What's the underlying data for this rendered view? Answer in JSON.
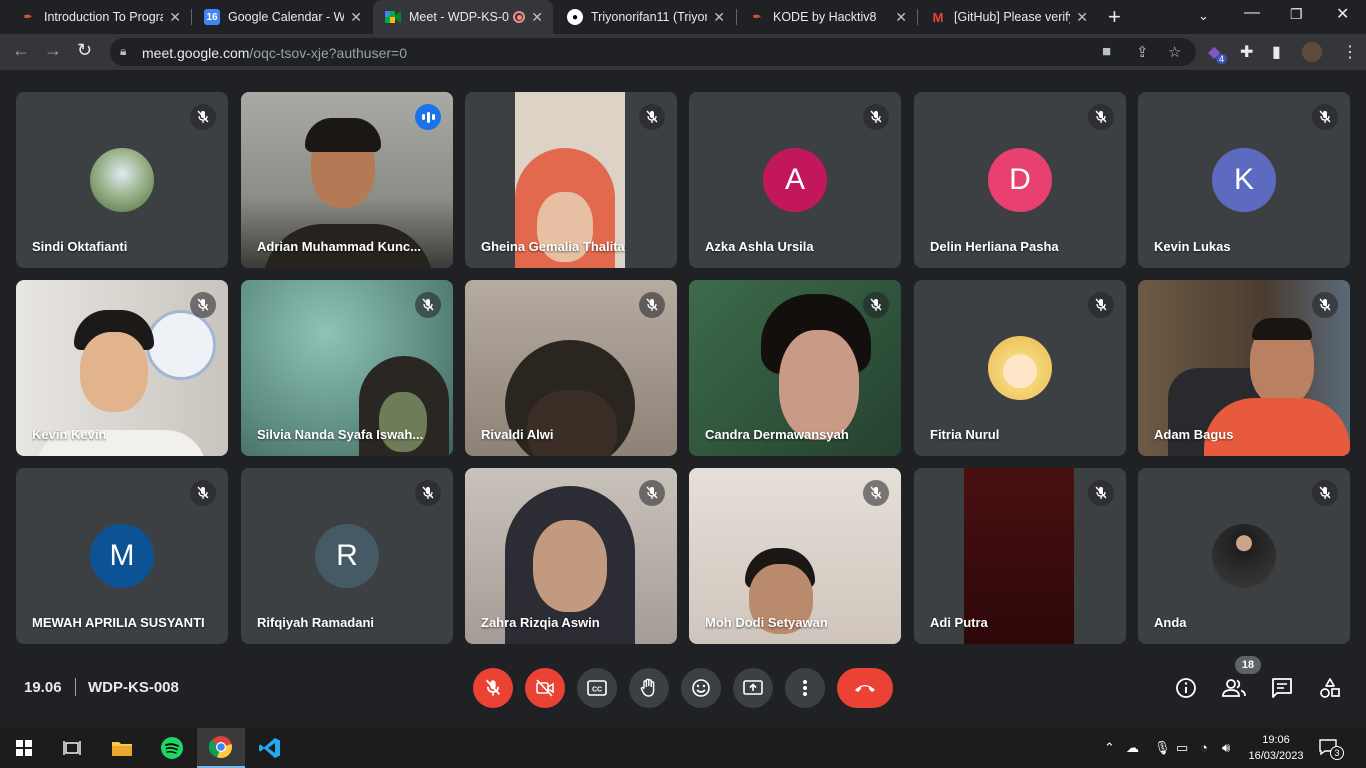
{
  "browser": {
    "tabs": [
      {
        "title": "Introduction To Progra",
        "favicon": "quill-icon",
        "color": "#e74c3c"
      },
      {
        "title": "Google Calendar - We",
        "favicon": "calendar-icon",
        "color": "#4285f4",
        "favtext": "16"
      },
      {
        "title": "Meet - WDP-KS-0",
        "favicon": "meet-icon",
        "color": "#00832d",
        "active": true
      },
      {
        "title": "Triyonorifan11 (Triyon",
        "favicon": "github-icon",
        "color": "#ffffff"
      },
      {
        "title": "KODE by Hacktiv8",
        "favicon": "quill-icon",
        "color": "#e74c3c"
      },
      {
        "title": "[GitHub] Please verify",
        "favicon": "gmail-icon",
        "color": "#ea4335",
        "favtext": "M"
      }
    ],
    "url_host": "meet.google.com",
    "url_path": "/oqc-tsov-xje?authuser=0",
    "extension_badge": "4"
  },
  "participants": [
    {
      "name": "Sindi Oktafianti",
      "type": "photo",
      "color": "#6b8f5a"
    },
    {
      "name": "Adrian Muhammad Kunc...",
      "type": "video",
      "color": "#8d8f8a",
      "speaking": true
    },
    {
      "name": "Gheina Gemalia Thalita",
      "type": "video",
      "color": "#d8cfc3"
    },
    {
      "name": "Azka Ashla Ursila",
      "type": "letter",
      "letter": "A",
      "color": "#c2185b"
    },
    {
      "name": "Delin Herliana Pasha",
      "type": "letter",
      "letter": "D",
      "color": "#e8416f"
    },
    {
      "name": "Kevin Lukas",
      "type": "letter",
      "letter": "K",
      "color": "#5c6bc0"
    },
    {
      "name": "Kevin Kevin",
      "type": "video",
      "color": "#cfcac4"
    },
    {
      "name": "Silvia Nanda Syafa Iswah...",
      "type": "video",
      "color": "#5d8c80"
    },
    {
      "name": "Rivaldi Alwi",
      "type": "video",
      "color": "#9a8a7a"
    },
    {
      "name": "Candra Dermawansyah",
      "type": "video",
      "color": "#2f5a3e"
    },
    {
      "name": "Fitria Nurul",
      "type": "photo",
      "color": "#f4d77b"
    },
    {
      "name": "Adam Bagus",
      "type": "video",
      "color": "#5b4a3a"
    },
    {
      "name": "MEWAH APRILIA SUSYANTI",
      "type": "letter",
      "letter": "M",
      "color": "#0b5394"
    },
    {
      "name": "Rifqiyah Ramadani",
      "type": "letter",
      "letter": "R",
      "color": "#455a64"
    },
    {
      "name": "Zahra Rizqia Aswin",
      "type": "video",
      "color": "#b7aea7"
    },
    {
      "name": "Moh Dodi Setyawan",
      "type": "video",
      "color": "#d6cdc6"
    },
    {
      "name": "Adi Putra",
      "type": "video",
      "color": "#4a1012"
    },
    {
      "name": "Anda",
      "type": "photo",
      "color": "#2a2a2a"
    }
  ],
  "meeting": {
    "time": "19.06",
    "code": "WDP-KS-008",
    "participant_count": "18"
  },
  "controls": [
    "mic-off-icon",
    "camera-off-icon",
    "captions-icon",
    "raise-hand-icon",
    "emoji-icon",
    "present-icon",
    "more-icon",
    "end-call-icon"
  ],
  "taskbar": {
    "time": "19:06",
    "date": "16/03/2023",
    "notifications": "3"
  }
}
